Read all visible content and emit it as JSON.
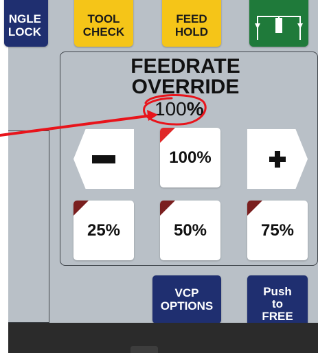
{
  "top_buttons": {
    "single_block": [
      "NGLE",
      "LOCK"
    ],
    "tool_check": [
      "TOOL",
      "CHECK"
    ],
    "feed_hold": [
      "FEED",
      "HOLD"
    ],
    "program_flow_icon": "program-flow-icon"
  },
  "feedrate_override": {
    "title_line1": "FEEDRATE",
    "title_line2": "OVERRIDE",
    "value": "100",
    "unit": "%",
    "decrease_icon": "minus",
    "increase_icon": "plus",
    "presets": {
      "p100": "100%",
      "p25": "25%",
      "p50": "50%",
      "p75": "75%"
    },
    "active_preset": "100%"
  },
  "bottom_buttons": {
    "vcp_options": [
      "VCP",
      "OPTIONS"
    ],
    "push_to_free": [
      "Push",
      "to",
      "FREE"
    ]
  },
  "annotation": {
    "color": "#e8141b"
  },
  "colors": {
    "panel": "#b9c0c7",
    "navy_button": "#1f2f70",
    "yellow_button": "#f5c518",
    "green_button": "#1f7a3a",
    "preset_corner": "#7a1f1f",
    "active_corner": "#e02828"
  }
}
